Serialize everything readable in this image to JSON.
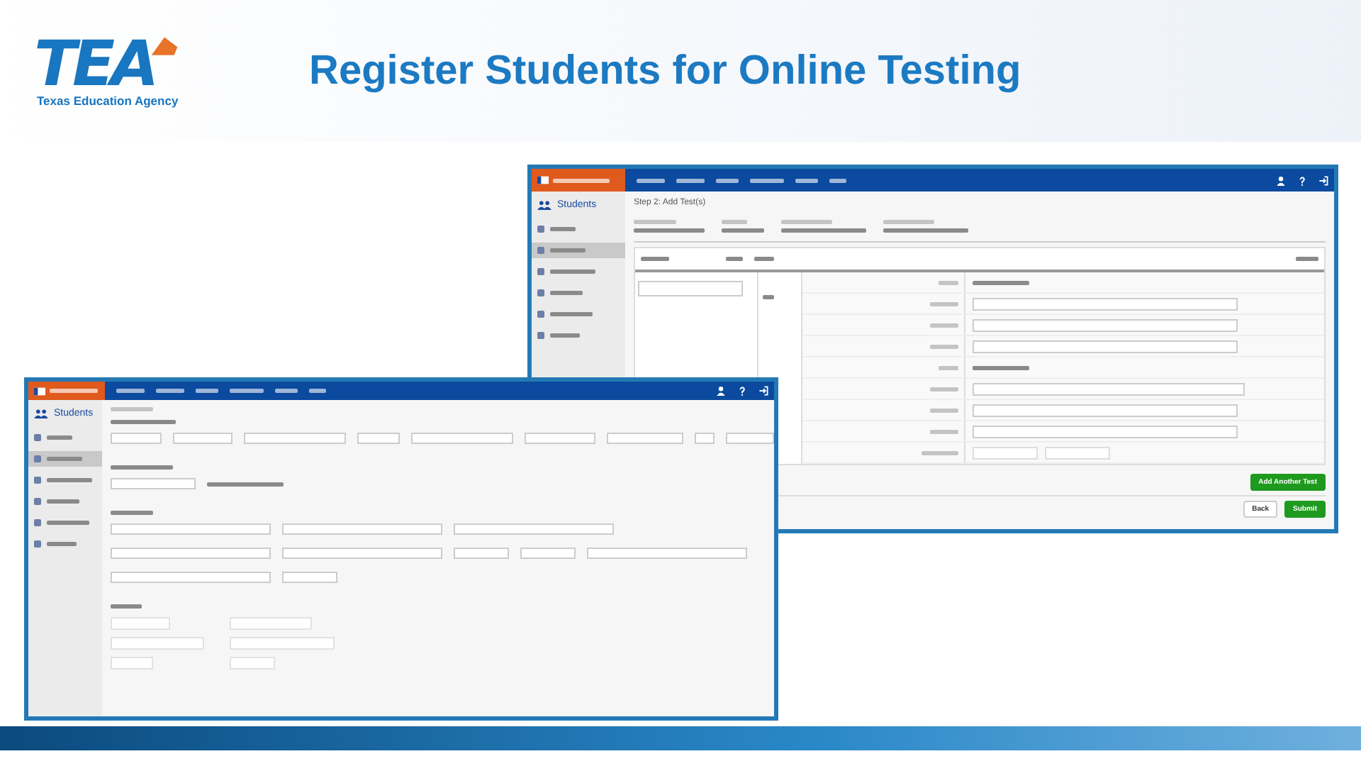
{
  "header": {
    "logo": {
      "wordmark": "TEA",
      "tagline": "Texas Education Agency"
    },
    "title": "Register Students for Online Testing"
  },
  "screenshots": [
    {
      "kind": "add-tests",
      "step": "Step 2: Add Test(s)",
      "sidebar_title": "Students",
      "sidebar_items": [
        {
          "selected": false
        },
        {
          "selected": true
        },
        {
          "selected": false
        },
        {
          "selected": false
        },
        {
          "selected": false
        },
        {
          "selected": false
        }
      ],
      "test_checkboxes": [
        {
          "checked": false
        },
        {
          "checked": false
        }
      ],
      "action_button": "Add Another Test",
      "footer_buttons": [
        {
          "label": "Back",
          "primary": false
        },
        {
          "label": "Submit",
          "primary": true
        }
      ]
    },
    {
      "kind": "enroll",
      "sidebar_title": "Students",
      "sidebar_items": [
        {
          "selected": false
        },
        {
          "selected": true
        },
        {
          "selected": false
        },
        {
          "selected": false
        },
        {
          "selected": false
        },
        {
          "selected": false
        }
      ],
      "checkboxes": [
        {
          "checked": false
        },
        {
          "checked": false
        },
        {
          "checked": false
        },
        {
          "checked": false
        },
        {
          "checked": false
        },
        {
          "checked": false
        }
      ]
    }
  ]
}
